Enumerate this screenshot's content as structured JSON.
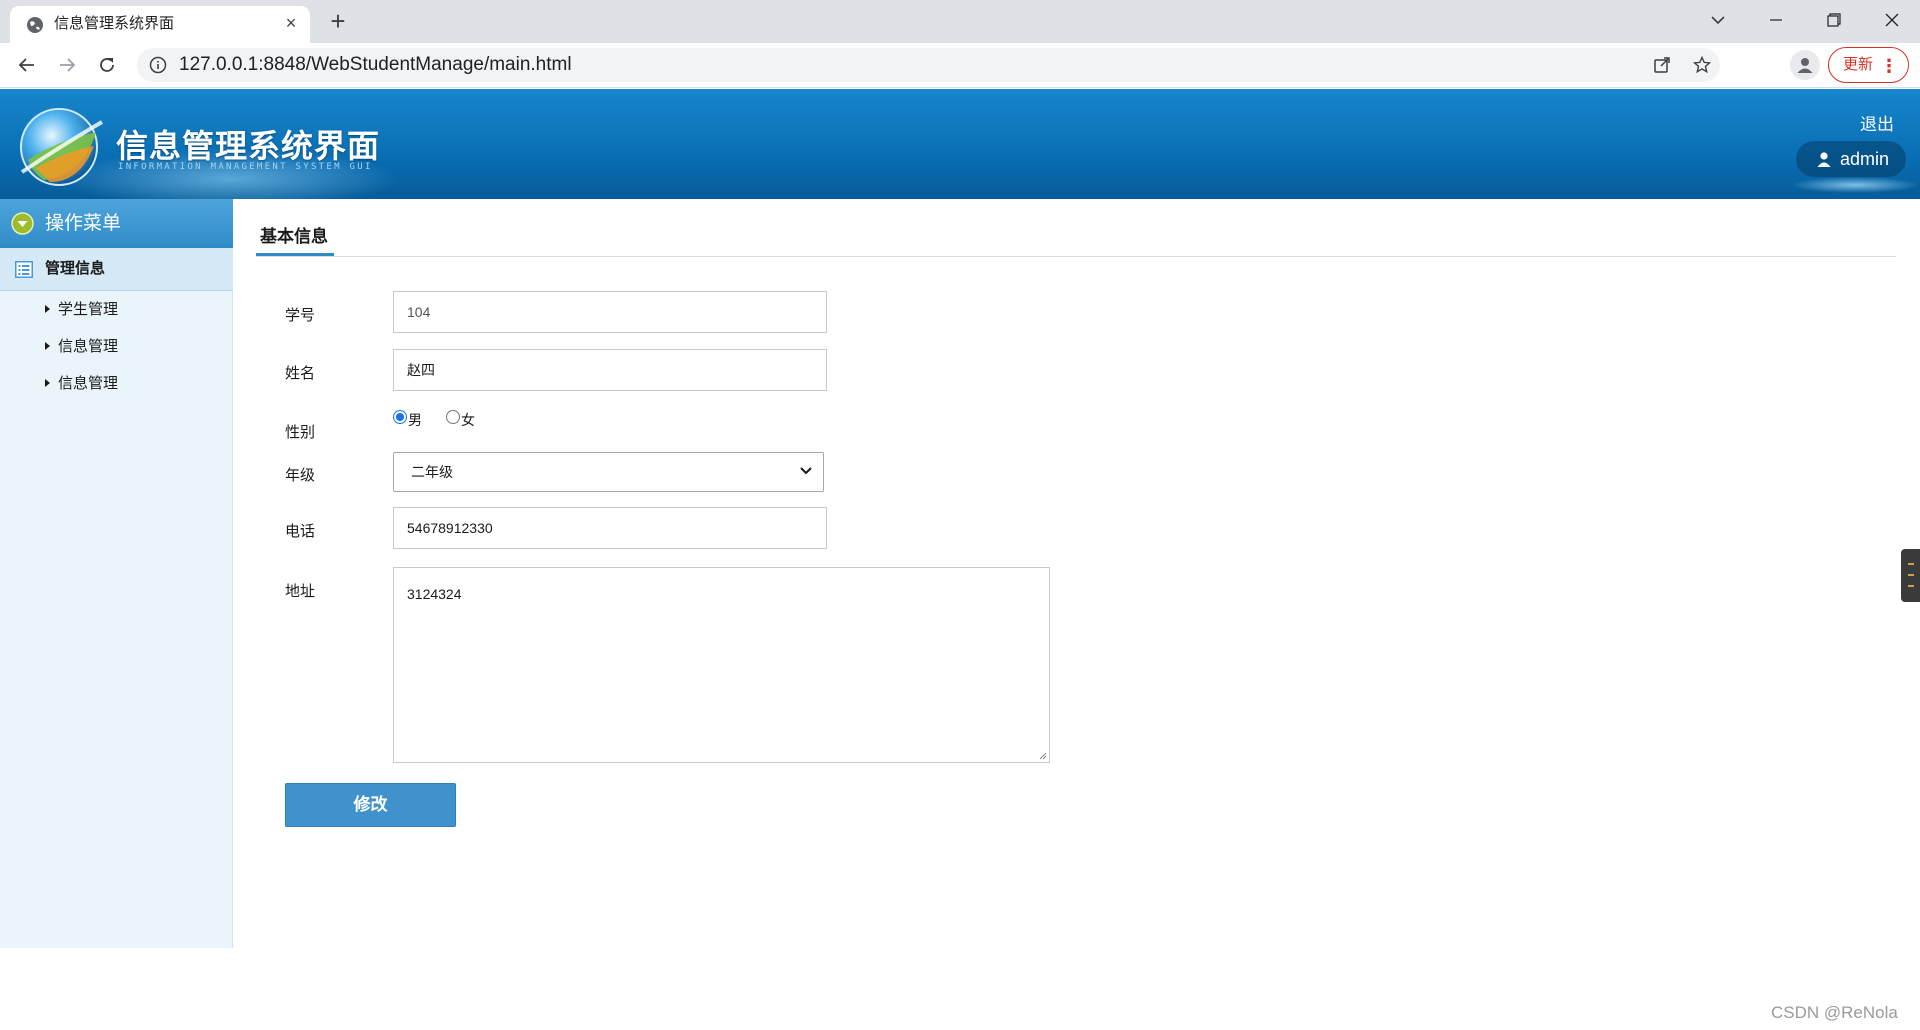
{
  "browser": {
    "tab_title": "信息管理系统界面",
    "tab_close": "×",
    "new_tab": "+",
    "url": "127.0.0.1:8848/WebStudentManage/main.html",
    "update_label": "更新",
    "update_menu": "⋮"
  },
  "header": {
    "brand_title": "信息管理系统界面",
    "brand_subtitle": "INFORMATION MANAGEMENT SYSTEM GUI",
    "logout": "退出",
    "user": "admin"
  },
  "sidebar": {
    "heading": "操作菜单",
    "group": "管理信息",
    "items": [
      {
        "label": "学生管理"
      },
      {
        "label": "信息管理"
      },
      {
        "label": "信息管理"
      }
    ]
  },
  "content": {
    "tab": "基本信息",
    "form": {
      "id_label": "学号",
      "id_value": "104",
      "name_label": "姓名",
      "name_value": "赵四",
      "gender_label": "性别",
      "gender_options": [
        "男",
        "女"
      ],
      "gender_selected": "男",
      "grade_label": "年级",
      "grade_value": "二年级",
      "phone_label": "电话",
      "phone_value": "54678912330",
      "address_label": "地址",
      "address_value": "3124324",
      "submit_label": "修改"
    }
  },
  "watermark": "CSDN @ReNola",
  "colors": {
    "header_blue": "#0a6fb5",
    "sidebar_bg": "#eaf4fb",
    "accent": "#2f8bc8",
    "button": "#3f92cc"
  }
}
